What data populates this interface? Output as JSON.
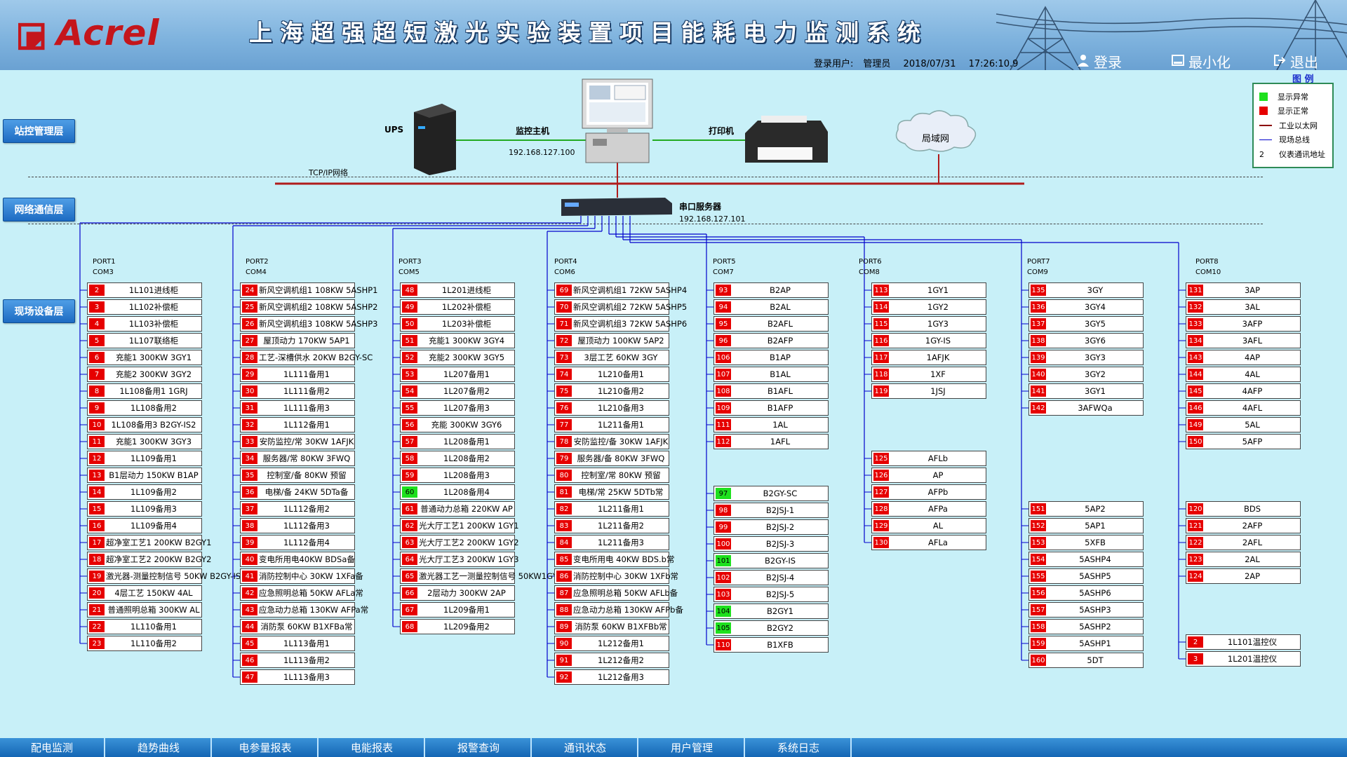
{
  "header": {
    "brand": "Acrel",
    "title": "上海超强超短激光实验装置项目能耗电力监测系统",
    "user_label": "登录用户:",
    "user": "管理员",
    "date": "2018/07/31",
    "time": "17:26:10.9",
    "login": "登录",
    "minimize": "最小化",
    "exit": "退出"
  },
  "layers": {
    "station": "站控管理层",
    "network": "网络通信层",
    "field": "现场设备层"
  },
  "topology": {
    "ups": "UPS",
    "host": "监控主机",
    "host_ip": "192.168.127.100",
    "printer": "打印机",
    "lan": "局域网",
    "tcpip": "TCP/IP网络",
    "serial_server": "串口服务器",
    "serial_ip": "192.168.127.101"
  },
  "legend": {
    "title": "图 例",
    "items": [
      "显示异常",
      "显示正常",
      "工业以太网",
      "现场总线",
      "仪表通讯地址"
    ],
    "addr_sample": "2",
    "colors": {
      "abnormal": "#1ee01e",
      "normal": "#e60000",
      "ethernet": "#8b0000",
      "fieldbus": "#0000cc"
    }
  },
  "ports": [
    {
      "port": "PORT1",
      "com": "COM3",
      "groups": [
        [
          [
            "2",
            "1L101进线柜"
          ],
          [
            "3",
            "1L102补偿柜"
          ],
          [
            "4",
            "1L103补偿柜"
          ],
          [
            "5",
            "1L107联络柜"
          ],
          [
            "6",
            "充能1 300KW 3GY1"
          ],
          [
            "7",
            "充能2 300KW 3GY2"
          ],
          [
            "8",
            "1L108备用1 1GRJ"
          ],
          [
            "9",
            "1L108备用2"
          ],
          [
            "10",
            "1L108备用3 B2GY-IS2"
          ],
          [
            "11",
            "充能1 300KW 3GY3"
          ],
          [
            "12",
            "1L109备用1"
          ],
          [
            "13",
            "B1层动力 150KW B1AP"
          ],
          [
            "14",
            "1L109备用2"
          ],
          [
            "15",
            "1L109备用3"
          ],
          [
            "16",
            "1L109备用4"
          ],
          [
            "17",
            "超净室工艺1 200KW B2GY1"
          ],
          [
            "18",
            "超净室工艺2 200KW B2GY2"
          ],
          [
            "19",
            "激光器-测量控制信号 50KW B2GY-IS"
          ],
          [
            "20",
            "4层工艺 150KW 4AL"
          ],
          [
            "21",
            "普通照明总箱 300KW AL"
          ],
          [
            "22",
            "1L110备用1"
          ],
          [
            "23",
            "1L110备用2"
          ]
        ]
      ]
    },
    {
      "port": "PORT2",
      "com": "COM4",
      "groups": [
        [
          [
            "24",
            "新风空调机组1 108KW 5ASHP1"
          ],
          [
            "25",
            "新风空调机组2 108KW 5ASHP2"
          ],
          [
            "26",
            "新风空调机组3 108KW 5ASHP3"
          ],
          [
            "27",
            "屋顶动力 170KW 5AP1"
          ],
          [
            "28",
            "工艺-深槽供水 20KW B2GY-SC"
          ],
          [
            "29",
            "1L111备用1"
          ],
          [
            "30",
            "1L111备用2"
          ],
          [
            "31",
            "1L111备用3"
          ],
          [
            "32",
            "1L112备用1"
          ],
          [
            "33",
            "安防监控/常 30KW 1AFJK"
          ],
          [
            "34",
            "服务器/常 80KW 3FWQ"
          ],
          [
            "35",
            "控制室/备 80KW 预留"
          ],
          [
            "36",
            "电梯/备 24KW 5DTa备"
          ],
          [
            "37",
            "1L112备用2"
          ],
          [
            "38",
            "1L112备用3"
          ],
          [
            "39",
            "1L112备用4"
          ],
          [
            "40",
            "变电所用电40KW BDSa备"
          ],
          [
            "41",
            "消防控制中心 30KW 1XFa备"
          ],
          [
            "42",
            "应急照明总箱 50KW AFLa常"
          ],
          [
            "43",
            "应急动力总箱 130KW AFPa常"
          ],
          [
            "44",
            "消防泵 60KW B1XFBa常"
          ],
          [
            "45",
            "1L113备用1"
          ],
          [
            "46",
            "1L113备用2"
          ],
          [
            "47",
            "1L113备用3"
          ]
        ]
      ]
    },
    {
      "port": "PORT3",
      "com": "COM5",
      "groups": [
        [
          [
            "48",
            "1L201进线柜"
          ],
          [
            "49",
            "1L202补偿柜"
          ],
          [
            "50",
            "1L203补偿柜"
          ],
          [
            "51",
            "充能1 300KW 3GY4"
          ],
          [
            "52",
            "充能2 300KW 3GY5"
          ],
          [
            "53",
            "1L207备用1"
          ],
          [
            "54",
            "1L207备用2"
          ],
          [
            "55",
            "1L207备用3"
          ],
          [
            "56",
            "充能 300KW 3GY6"
          ],
          [
            "57",
            "1L208备用1"
          ],
          [
            "58",
            "1L208备用2"
          ],
          [
            "59",
            "1L208备用3"
          ],
          [
            "60",
            "1L208备用4"
          ],
          [
            "61",
            "普通动力总箱 220KW AP"
          ],
          [
            "62",
            "光大厅工艺1 200KW 1GY1"
          ],
          [
            "63",
            "光大厅工艺2 200KW 1GY2"
          ],
          [
            "64",
            "光大厅工艺3 200KW 1GY3"
          ],
          [
            "65",
            "激光器工艺一测量控制信号 50KW1GY-IS"
          ],
          [
            "66",
            "2层动力 300KW 2AP"
          ],
          [
            "67",
            "1L209备用1"
          ],
          [
            "68",
            "1L209备用2"
          ]
        ]
      ]
    },
    {
      "port": "PORT4",
      "com": "COM6",
      "groups": [
        [
          [
            "69",
            "新风空调机组1 72KW 5ASHP4"
          ],
          [
            "70",
            "新风空调机组2 72KW 5ASHP5"
          ],
          [
            "71",
            "新风空调机组3 72KW 5ASHP6"
          ],
          [
            "72",
            "屋顶动力 100KW 5AP2"
          ],
          [
            "73",
            "3层工艺 60KW 3GY"
          ],
          [
            "74",
            "1L210备用1"
          ],
          [
            "75",
            "1L210备用2"
          ],
          [
            "76",
            "1L210备用3"
          ],
          [
            "77",
            "1L211备用1"
          ],
          [
            "78",
            "安防监控/备 30KW 1AFJK"
          ],
          [
            "79",
            "服务器/备 80KW 3FWQ"
          ],
          [
            "80",
            "控制室/常 80KW 预留"
          ],
          [
            "81",
            "电梯/常 25KW 5DTb常"
          ],
          [
            "82",
            "1L211备用1"
          ],
          [
            "83",
            "1L211备用2"
          ],
          [
            "84",
            "1L211备用3"
          ],
          [
            "85",
            "变电所用电 40KW BDS.b常"
          ],
          [
            "86",
            "消防控制中心 30KW 1XFb常"
          ],
          [
            "87",
            "应急照明总箱 50KW AFLb备"
          ],
          [
            "88",
            "应急动力总箱 130KW AFPb备"
          ],
          [
            "89",
            "消防泵 60KW B1XFBb常"
          ],
          [
            "90",
            "1L212备用1"
          ],
          [
            "91",
            "1L212备用2"
          ],
          [
            "92",
            "1L212备用3"
          ]
        ]
      ]
    },
    {
      "port": "PORT5",
      "com": "COM7",
      "groups": [
        [
          [
            "93",
            "B2AP"
          ],
          [
            "94",
            "B2AL"
          ],
          [
            "95",
            "B2AFL"
          ],
          [
            "96",
            "B2AFP"
          ],
          [
            "106",
            "B1AP"
          ],
          [
            "107",
            "B1AL"
          ],
          [
            "108",
            "B1AFL"
          ],
          [
            "109",
            "B1AFP"
          ],
          [
            "111",
            "1AL"
          ],
          [
            "112",
            "1AFL"
          ]
        ],
        [
          [
            "97",
            "B2GY-SC"
          ],
          [
            "98",
            "B2JSJ-1"
          ],
          [
            "99",
            "B2JSJ-2"
          ],
          [
            "100",
            "B2JSJ-3"
          ],
          [
            "101",
            "B2GY-IS"
          ],
          [
            "102",
            "B2JSJ-4"
          ],
          [
            "103",
            "B2JSJ-5"
          ],
          [
            "104",
            "B2GY1"
          ],
          [
            "105",
            "B2GY2"
          ],
          [
            "110",
            "B1XFB"
          ]
        ]
      ]
    },
    {
      "port": "PORT6",
      "com": "COM8",
      "groups": [
        [
          [
            "113",
            "1GY1"
          ],
          [
            "114",
            "1GY2"
          ],
          [
            "115",
            "1GY3"
          ],
          [
            "116",
            "1GY-IS"
          ],
          [
            "117",
            "1AFJK"
          ],
          [
            "118",
            "1XF"
          ],
          [
            "119",
            "1JSJ"
          ]
        ],
        [
          [
            "125",
            "AFLb"
          ],
          [
            "126",
            "AP"
          ],
          [
            "127",
            "AFPb"
          ],
          [
            "128",
            "AFPa"
          ],
          [
            "129",
            "AL"
          ],
          [
            "130",
            "AFLa"
          ]
        ]
      ]
    },
    {
      "port": "PORT7",
      "com": "COM9",
      "groups": [
        [
          [
            "135",
            "3GY"
          ],
          [
            "136",
            "3GY4"
          ],
          [
            "137",
            "3GY5"
          ],
          [
            "138",
            "3GY6"
          ],
          [
            "139",
            "3GY3"
          ],
          [
            "140",
            "3GY2"
          ],
          [
            "141",
            "3GY1"
          ],
          [
            "142",
            "3AFWQa"
          ]
        ],
        [
          [
            "151",
            "5AP2"
          ],
          [
            "152",
            "5AP1"
          ],
          [
            "153",
            "5XFB"
          ],
          [
            "154",
            "5ASHP4"
          ],
          [
            "155",
            "5ASHP5"
          ],
          [
            "156",
            "5ASHP6"
          ],
          [
            "157",
            "5ASHP3"
          ],
          [
            "158",
            "5ASHP2"
          ],
          [
            "159",
            "5ASHP1"
          ],
          [
            "160",
            "5DT"
          ]
        ]
      ]
    },
    {
      "port": "PORT8",
      "com": "COM10",
      "groups": [
        [
          [
            "131",
            "3AP"
          ],
          [
            "132",
            "3AL"
          ],
          [
            "133",
            "3AFP"
          ],
          [
            "134",
            "3AFL"
          ],
          [
            "143",
            "4AP"
          ],
          [
            "144",
            "4AL"
          ],
          [
            "145",
            "4AFP"
          ],
          [
            "146",
            "4AFL"
          ],
          [
            "149",
            "5AL"
          ],
          [
            "150",
            "5AFP"
          ]
        ],
        [
          [
            "120",
            "BDS"
          ],
          [
            "121",
            "2AFP"
          ],
          [
            "122",
            "2AFL"
          ],
          [
            "123",
            "2AL"
          ],
          [
            "124",
            "2AP"
          ]
        ],
        [
          [
            "2",
            "1L101温控仪"
          ],
          [
            "3",
            "1L201温控仪"
          ]
        ]
      ]
    }
  ],
  "normal_status_ids": [
    "60",
    "97",
    "101",
    "104",
    "105"
  ],
  "nav": [
    "配电监测",
    "趋势曲线",
    "电参量报表",
    "电能报表",
    "报警查询",
    "通讯状态",
    "用户管理",
    "系统日志"
  ]
}
